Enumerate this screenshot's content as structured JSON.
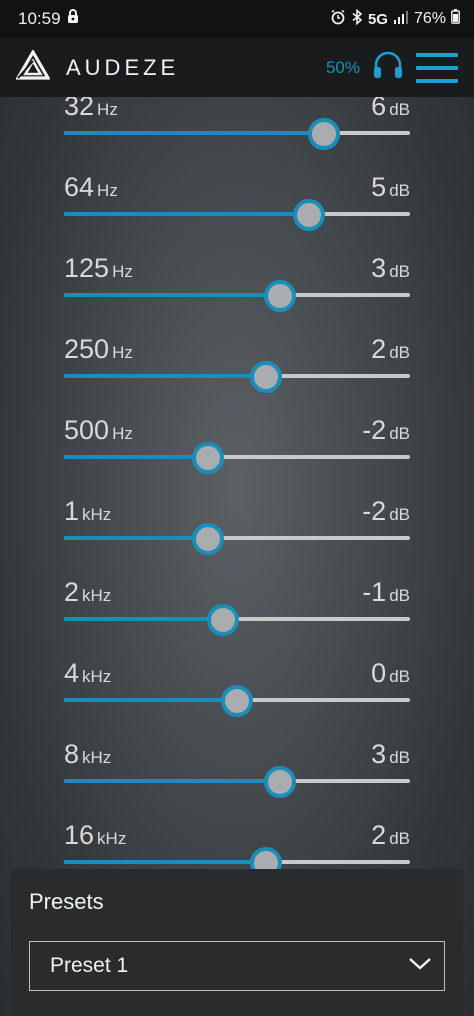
{
  "status": {
    "time": "10:59",
    "network": "5G",
    "battery": "76%"
  },
  "app": {
    "brand": "AUDEZE",
    "volume": "50%"
  },
  "eq": {
    "min_db": -12,
    "max_db": 12,
    "bands": [
      {
        "freq": "32",
        "unit": "Hz",
        "gain": "6",
        "gain_unit": "dB",
        "db": 6
      },
      {
        "freq": "64",
        "unit": "Hz",
        "gain": "5",
        "gain_unit": "dB",
        "db": 5
      },
      {
        "freq": "125",
        "unit": "Hz",
        "gain": "3",
        "gain_unit": "dB",
        "db": 3
      },
      {
        "freq": "250",
        "unit": "Hz",
        "gain": "2",
        "gain_unit": "dB",
        "db": 2
      },
      {
        "freq": "500",
        "unit": "Hz",
        "gain": "-2",
        "gain_unit": "dB",
        "db": -2
      },
      {
        "freq": "1",
        "unit": "kHz",
        "gain": "-2",
        "gain_unit": "dB",
        "db": -2
      },
      {
        "freq": "2",
        "unit": "kHz",
        "gain": "-1",
        "gain_unit": "dB",
        "db": -1
      },
      {
        "freq": "4",
        "unit": "kHz",
        "gain": "0",
        "gain_unit": "dB",
        "db": 0
      },
      {
        "freq": "8",
        "unit": "kHz",
        "gain": "3",
        "gain_unit": "dB",
        "db": 3
      },
      {
        "freq": "16",
        "unit": "kHz",
        "gain": "2",
        "gain_unit": "dB",
        "db": 2
      }
    ]
  },
  "presets": {
    "title": "Presets",
    "selected": "Preset 1"
  },
  "colors": {
    "accent": "#1a8db8",
    "track": "#c9c9c9",
    "thumb": "#a9adb0"
  },
  "icons": {
    "status": [
      "lock-icon",
      "alarm-icon",
      "bluetooth-icon",
      "signal-icon",
      "battery-icon"
    ],
    "appbar": [
      "audeze-logo-icon",
      "headphones-icon",
      "menu-icon"
    ],
    "presets": "chevron-down-icon"
  }
}
